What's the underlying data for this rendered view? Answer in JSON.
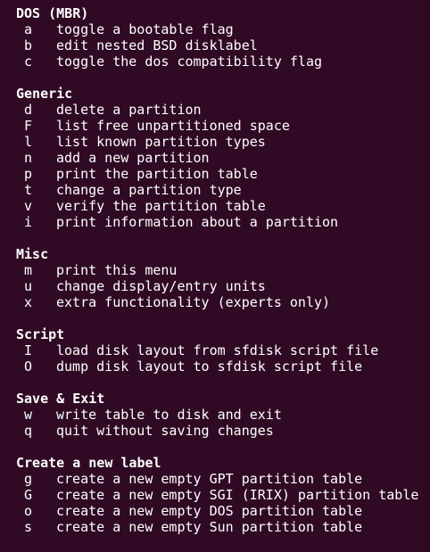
{
  "terminal": {
    "sections": [
      {
        "title": "DOS (MBR)",
        "commands": [
          {
            "key": "a",
            "desc": "toggle a bootable flag"
          },
          {
            "key": "b",
            "desc": "edit nested BSD disklabel"
          },
          {
            "key": "c",
            "desc": "toggle the dos compatibility flag"
          }
        ]
      },
      {
        "title": "Generic",
        "commands": [
          {
            "key": "d",
            "desc": "delete a partition"
          },
          {
            "key": "F",
            "desc": "list free unpartitioned space"
          },
          {
            "key": "l",
            "desc": "list known partition types"
          },
          {
            "key": "n",
            "desc": "add a new partition"
          },
          {
            "key": "p",
            "desc": "print the partition table"
          },
          {
            "key": "t",
            "desc": "change a partition type"
          },
          {
            "key": "v",
            "desc": "verify the partition table"
          },
          {
            "key": "i",
            "desc": "print information about a partition"
          }
        ]
      },
      {
        "title": "Misc",
        "commands": [
          {
            "key": "m",
            "desc": "print this menu"
          },
          {
            "key": "u",
            "desc": "change display/entry units"
          },
          {
            "key": "x",
            "desc": "extra functionality (experts only)"
          }
        ]
      },
      {
        "title": "Script",
        "commands": [
          {
            "key": "I",
            "desc": "load disk layout from sfdisk script file"
          },
          {
            "key": "O",
            "desc": "dump disk layout to sfdisk script file"
          }
        ]
      },
      {
        "title": "Save & Exit",
        "commands": [
          {
            "key": "w",
            "desc": "write table to disk and exit"
          },
          {
            "key": "q",
            "desc": "quit without saving changes"
          }
        ]
      },
      {
        "title": "Create a new label",
        "commands": [
          {
            "key": "g",
            "desc": "create a new empty GPT partition table"
          },
          {
            "key": "G",
            "desc": "create a new empty SGI (IRIX) partition table"
          },
          {
            "key": "o",
            "desc": "create a new empty DOS partition table"
          },
          {
            "key": "s",
            "desc": "create a new empty Sun partition table"
          }
        ]
      }
    ]
  },
  "colors": {
    "background": "#300a24",
    "text": "#ffffff"
  }
}
